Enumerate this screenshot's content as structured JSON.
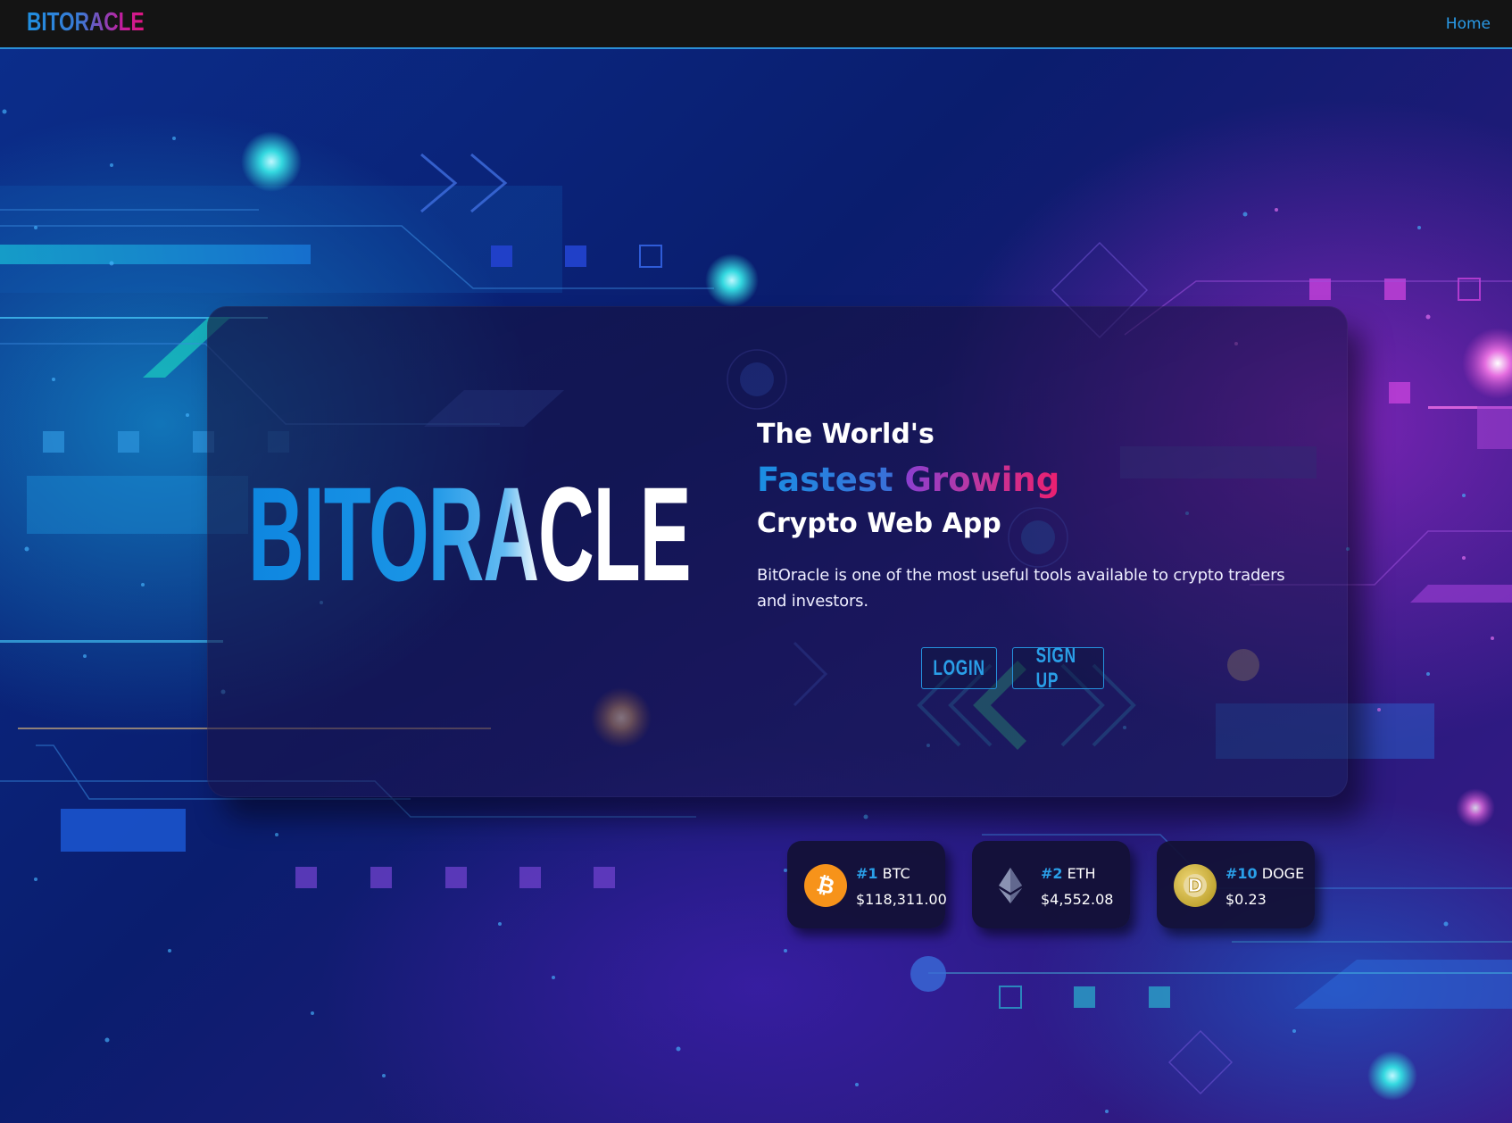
{
  "navbar": {
    "brand": "BITORACLE",
    "home_link": "Home"
  },
  "hero": {
    "logo_text": "BITORACLE",
    "headline_line1": "The World's",
    "headline_fastest": "Fastest",
    "headline_growing": "Growing",
    "headline_line3": "Crypto Web App",
    "description": "BitOracle is one of the most useful tools available to crypto traders and investors.",
    "login_label": "LOGIN",
    "signup_label": "SIGN UP"
  },
  "coins": [
    {
      "rank": "#1",
      "symbol": "BTC",
      "price": "$118,311.00",
      "icon": "bitcoin-icon",
      "color": "#f7931a"
    },
    {
      "rank": "#2",
      "symbol": "ETH",
      "price": "$4,552.08",
      "icon": "ethereum-icon",
      "color": "#8a92b2"
    },
    {
      "rank": "#10",
      "symbol": "DOGE",
      "price": "$0.23",
      "icon": "dogecoin-icon",
      "color": "#c2a633"
    }
  ],
  "colors": {
    "accent_blue": "#2a9fe8",
    "accent_pink": "#e0157f",
    "navbar_bg": "#141414"
  }
}
